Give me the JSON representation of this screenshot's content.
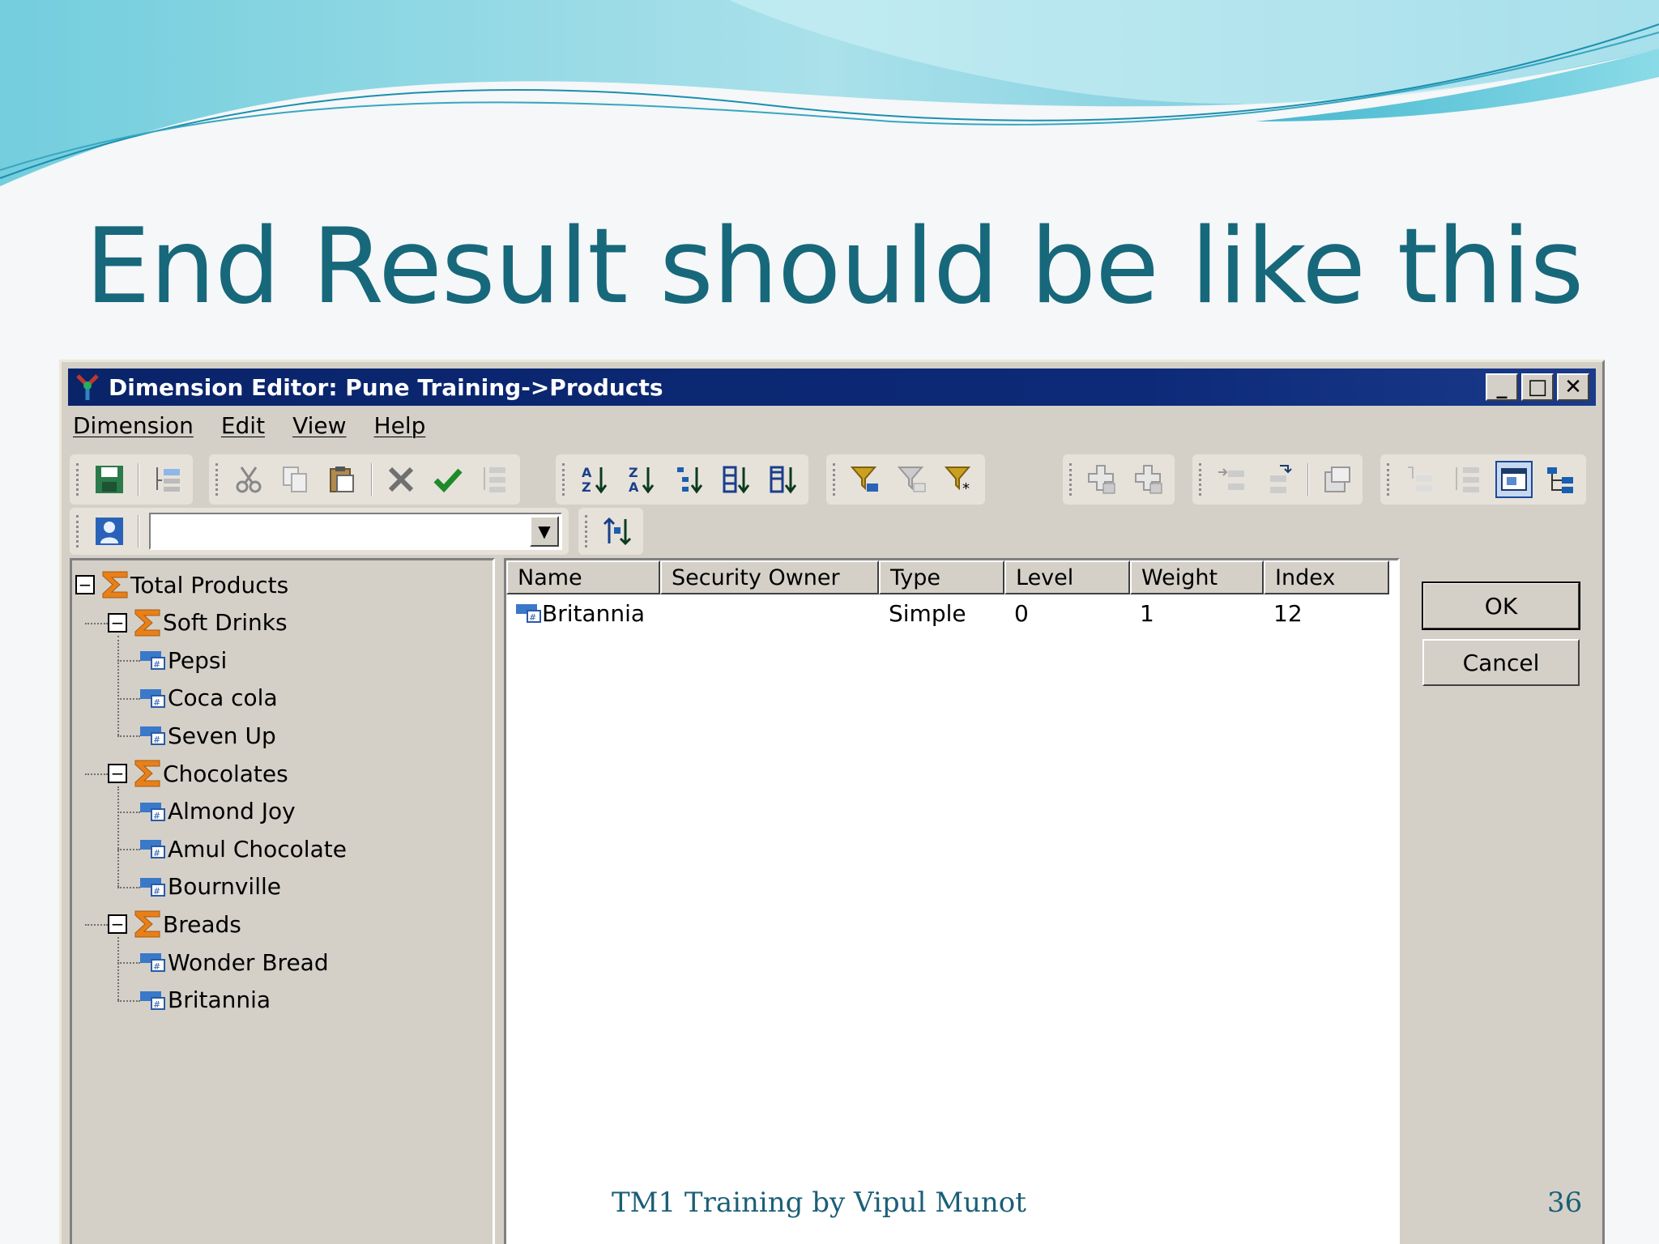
{
  "slide": {
    "title": "End Result should be like this",
    "footer": "TM1 Training by Vipul Munot",
    "page_number": "36"
  },
  "window": {
    "title": "Dimension Editor: Pune Training->Products",
    "caption_buttons": {
      "minimize": "_",
      "maximize": "□",
      "close": "✕"
    }
  },
  "menu": [
    "Dimension",
    "Edit",
    "View",
    "Help"
  ],
  "toolbar": {
    "groups": [
      [
        "save-icon",
        "insert-element-icon"
      ],
      [
        "cut-icon",
        "copy-icon",
        "paste-icon",
        "delete-icon",
        "check-icon",
        "hierarchy-icon"
      ],
      [
        "sort-az-icon",
        "sort-za-icon",
        "sort-index-asc-icon",
        "sort-hierarchy-icon",
        "sort-hierarchy-desc-icon"
      ],
      [
        "filter-icon",
        "filter-clear-icon",
        "filter-wildcard-icon"
      ],
      [
        "expand-icon",
        "collapse-icon"
      ],
      [
        "insert-child-icon",
        "insert-sibling-icon",
        "properties-icon"
      ],
      [
        "show-parents-icon",
        "show-children-icon",
        "window-icon",
        "tree-icon"
      ]
    ],
    "subset_combo_value": "",
    "sort_button_icon": "sort-order-icon"
  },
  "tree": {
    "root": {
      "label": "Total Products",
      "kind": "consolidated"
    },
    "children": [
      {
        "label": "Soft Drinks",
        "kind": "consolidated",
        "children": [
          "Pepsi",
          "Coca cola",
          "Seven Up"
        ]
      },
      {
        "label": "Chocolates",
        "kind": "consolidated",
        "children": [
          "Almond Joy",
          "Amul Chocolate",
          "Bournville"
        ]
      },
      {
        "label": "Breads",
        "kind": "consolidated",
        "children": [
          "Wonder Bread",
          "Britannia"
        ]
      }
    ]
  },
  "grid": {
    "columns": [
      "Name",
      "Security Owner",
      "Type",
      "Level",
      "Weight",
      "Index"
    ],
    "rows": [
      {
        "name": "Britannia",
        "security_owner": "",
        "type": "Simple",
        "level": "0",
        "weight": "1",
        "index": "12"
      }
    ]
  },
  "buttons": {
    "ok": "OK",
    "cancel": "Cancel"
  },
  "colors": {
    "title_teal": "#17687b",
    "titlebar_navy": "#0a246a",
    "dialog_gray": "#d4d0c8",
    "sigma_orange": "#e8801a",
    "element_blue": "#3a78c8"
  }
}
